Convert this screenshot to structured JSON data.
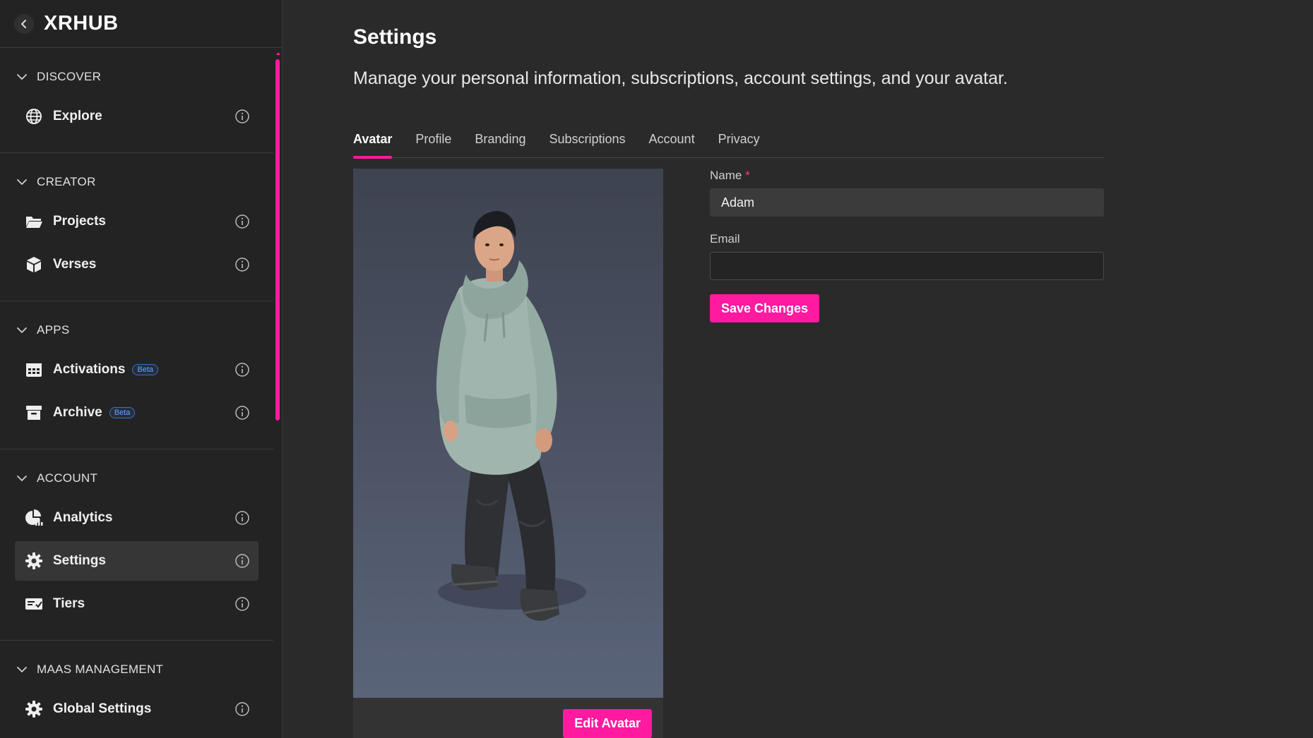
{
  "app": {
    "title": "XRHUB"
  },
  "sidebar": {
    "sections": [
      {
        "title": "DISCOVER",
        "items": [
          {
            "label": "Explore",
            "icon": "globe-icon"
          }
        ]
      },
      {
        "title": "CREATOR",
        "items": [
          {
            "label": "Projects",
            "icon": "folder-icon"
          },
          {
            "label": "Verses",
            "icon": "cube-icon"
          }
        ]
      },
      {
        "title": "APPS",
        "items": [
          {
            "label": "Activations",
            "icon": "calendar-icon",
            "badge": "Beta"
          },
          {
            "label": "Archive",
            "icon": "archive-box-icon",
            "badge": "Beta"
          }
        ]
      },
      {
        "title": "ACCOUNT",
        "items": [
          {
            "label": "Analytics",
            "icon": "pie-chart-icon"
          },
          {
            "label": "Settings",
            "icon": "gear-icon",
            "active": true
          },
          {
            "label": "Tiers",
            "icon": "ticket-icon"
          }
        ]
      },
      {
        "title": "MAAS MANAGEMENT",
        "items": [
          {
            "label": "Global Settings",
            "icon": "gear-icon"
          }
        ]
      }
    ]
  },
  "main": {
    "title": "Settings",
    "description": "Manage your personal information, subscriptions, account settings, and your avatar.",
    "tabs": [
      {
        "label": "Avatar",
        "active": true
      },
      {
        "label": "Profile"
      },
      {
        "label": "Branding"
      },
      {
        "label": "Subscriptions"
      },
      {
        "label": "Account"
      },
      {
        "label": "Privacy"
      }
    ],
    "avatar": {
      "edit_label": "Edit Avatar"
    },
    "form": {
      "name_label": "Name",
      "required_mark": "*",
      "name_value": "Adam",
      "email_label": "Email",
      "email_value": "",
      "save_label": "Save Changes"
    }
  },
  "colors": {
    "accent": "#ff1aa0",
    "background": "#2a2a2a",
    "sidebar": "#232323",
    "badge": "#5fa8ff"
  }
}
